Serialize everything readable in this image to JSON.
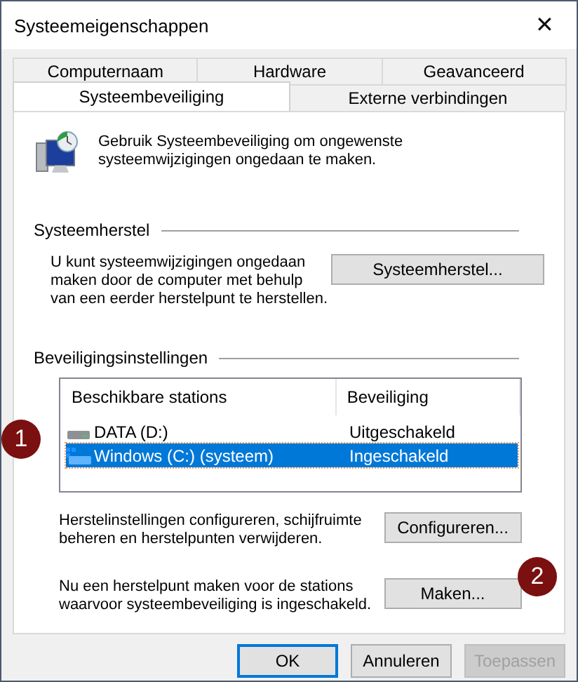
{
  "window": {
    "title": "Systeemeigenschappen",
    "close": "✕"
  },
  "tab_rows": [
    [
      {
        "label": "Computernaam",
        "selected": false
      },
      {
        "label": "Hardware",
        "selected": false
      },
      {
        "label": "Geavanceerd",
        "selected": false
      }
    ],
    [
      {
        "label": "Systeembeveiliging",
        "selected": true
      },
      {
        "label": "Externe verbindingen",
        "selected": false
      }
    ]
  ],
  "intro": "Gebruik Systeembeveiliging om ongewenste systeemwijzigingen ongedaan te maken.",
  "restore": {
    "heading": "Systeemherstel",
    "text": "U kunt systeemwijzigingen ongedaan maken door de computer met behulp van een eerder herstelpunt te herstellen.",
    "button": "Systeemherstel..."
  },
  "protection": {
    "heading": "Beveiligingsinstellingen",
    "columns": [
      "Beschikbare stations",
      "Beveiliging"
    ],
    "rows": [
      {
        "kind": "data",
        "name": "DATA (D:)",
        "status": "Uitgeschakeld",
        "selected": false
      },
      {
        "kind": "system",
        "name": "Windows (C:) (systeem)",
        "status": "Ingeschakeld",
        "selected": true
      }
    ],
    "configure_text": "Herstelinstellingen configureren, schijfruimte beheren en herstelpunten verwijderen.",
    "configure_button": "Configureren...",
    "create_text": "Nu een herstelpunt maken voor de stations waarvoor systeembeveiliging is ingeschakeld.",
    "create_button": "Maken..."
  },
  "buttons": [
    {
      "label": "OK",
      "default": true,
      "disabled": false
    },
    {
      "label": "Annuleren",
      "default": false,
      "disabled": false
    },
    {
      "label": "Toepassen",
      "default": false,
      "disabled": true
    }
  ],
  "callouts": [
    "1",
    "2"
  ]
}
